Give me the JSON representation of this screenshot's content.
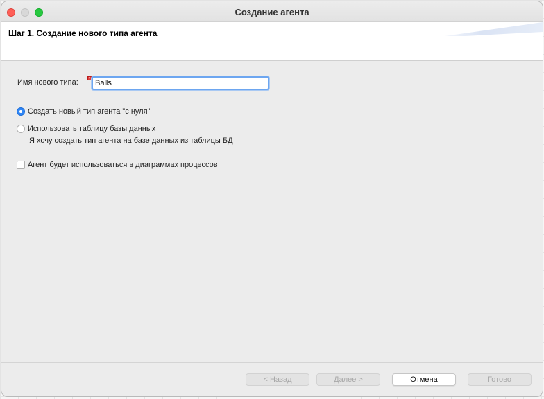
{
  "window": {
    "title": "Создание агента"
  },
  "header": {
    "step_title": "Шаг 1. Создание нового типа агента"
  },
  "form": {
    "name_label": "Имя нового типа:",
    "name_value": "Balls",
    "create_from_scratch_label": "Создать новый тип агента \"с нуля\"",
    "create_from_scratch_selected": true,
    "use_db_table_label": "Использовать таблицу базы данных",
    "use_db_table_selected": false,
    "use_db_table_hint": "Я хочу создать тип агента на базе данных из таблицы БД",
    "process_diagrams_label": "Агент будет использоваться в диаграммах процессов",
    "process_diagrams_checked": false
  },
  "footer": {
    "back_label": "< Назад",
    "next_label": "Далее >",
    "cancel_label": "Отмена",
    "finish_label": "Готово"
  },
  "colors": {
    "accent": "#2f86f6",
    "focus_ring": "#6da6f0",
    "close": "#fe5f57",
    "zoom": "#28c840",
    "error_marker": "#e03a3a"
  }
}
